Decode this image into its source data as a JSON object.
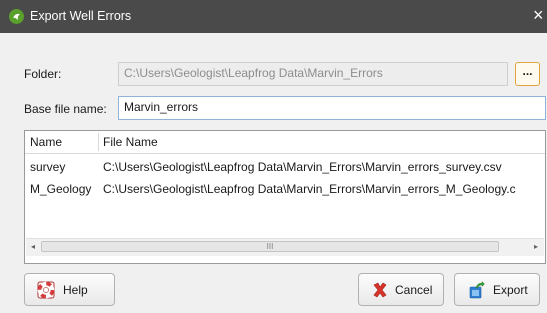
{
  "window": {
    "title": "Export Well Errors",
    "close_glyph": "×"
  },
  "form": {
    "folder_label": "Folder:",
    "folder_value": "C:\\Users\\Geologist\\Leapfrog Data\\Marvin_Errors",
    "browse_label": "...",
    "base_label": "Base file name:",
    "base_value": "Marvin_errors"
  },
  "table": {
    "columns": [
      "Name",
      "File Name"
    ],
    "rows": [
      {
        "name": "survey",
        "file": "C:\\Users\\Geologist\\Leapfrog Data\\Marvin_Errors\\Marvin_errors_survey.csv"
      },
      {
        "name": "M_Geology",
        "file": "C:\\Users\\Geologist\\Leapfrog Data\\Marvin_Errors\\Marvin_errors_M_Geology.c"
      }
    ],
    "scroll_left": "◂",
    "scroll_right": "▸",
    "scroll_grip": "III"
  },
  "buttons": {
    "help_label": "Help",
    "cancel_label": "Cancel",
    "export_label": "Export"
  },
  "icons": {
    "app": "leapfrog-icon",
    "help": "lifebuoy-icon",
    "cancel": "red-x-icon",
    "export": "export-arrow-icon"
  },
  "colors": {
    "titlebar": "#4a4a4a",
    "browse_border": "#e3a33f",
    "app_icon": "#5aa02c"
  }
}
